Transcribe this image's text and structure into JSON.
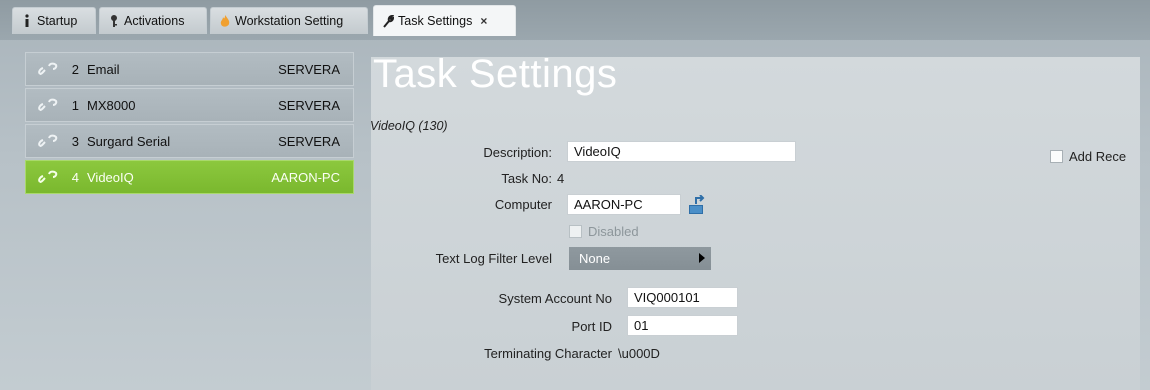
{
  "tabs": [
    {
      "label": "Startup",
      "icon": "info-icon"
    },
    {
      "label": "Activations",
      "icon": "key-icon"
    },
    {
      "label": "Workstation Setting",
      "icon": "flame-icon"
    },
    {
      "label": "Task Settings",
      "icon": "wrench-icon",
      "close": "×"
    }
  ],
  "tasks": [
    {
      "num": "2",
      "name": "Email",
      "server": "SERVERA"
    },
    {
      "num": "1",
      "name": "MX8000",
      "server": "SERVERA"
    },
    {
      "num": "3",
      "name": "Surgard Serial",
      "server": "SERVERA"
    },
    {
      "num": "4",
      "name": "VideoIQ",
      "server": "AARON-PC"
    }
  ],
  "page": {
    "title": "Task Settings",
    "subtitle": "VideoIQ (130)"
  },
  "form": {
    "description_label": "Description:",
    "description_value": "VideoIQ",
    "task_no_label": "Task No:",
    "task_no_value": "4",
    "computer_label": "Computer",
    "computer_value": "AARON-PC",
    "disabled_label": "Disabled",
    "log_filter_label": "Text Log Filter Level",
    "log_filter_value": "None",
    "add_rec_label": "Add Rece",
    "system_account_label": "System Account No",
    "system_account_value": "VIQ000101",
    "port_id_label": "Port ID",
    "port_id_value": "01",
    "terminating_label": "Terminating Character",
    "terminating_value": "\\u000D"
  },
  "colors": {
    "selected_item": "#84c236",
    "panel": "#d0d6d9"
  }
}
